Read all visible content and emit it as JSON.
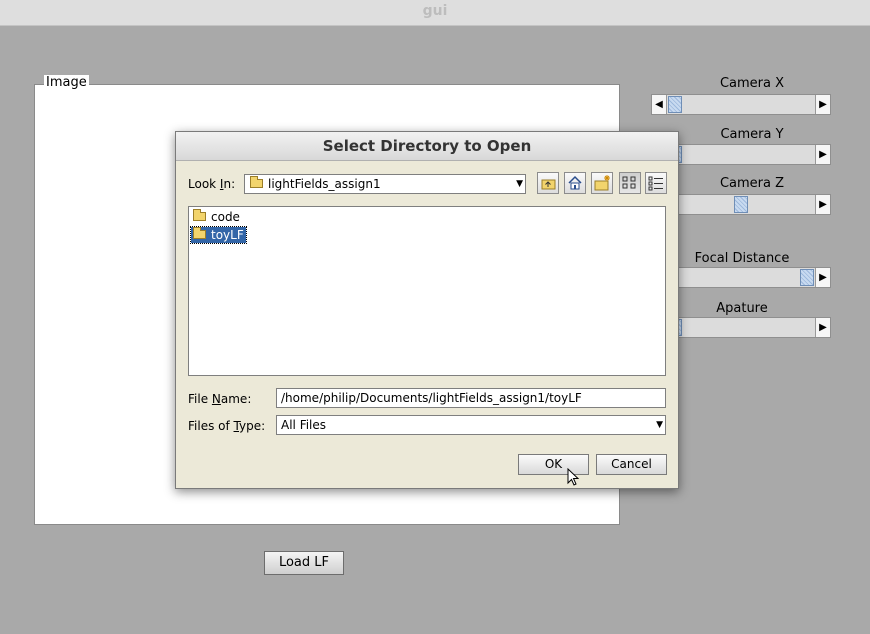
{
  "window": {
    "title": "gui"
  },
  "image_panel": {
    "legend": "Image"
  },
  "load_button": {
    "label": "Load LF"
  },
  "sliders": [
    {
      "label": "Camera X",
      "value_fraction": 0.09
    },
    {
      "label": "Camera Y",
      "value_fraction": 0.05
    },
    {
      "label": "Camera Z",
      "value_fraction": 0.5
    },
    {
      "label": "Focal Distance",
      "value_fraction": 0.97
    },
    {
      "label": "Apature",
      "value_fraction": 0.05
    }
  ],
  "dialog": {
    "title": "Select Directory to Open",
    "look_in_label": "Look In:",
    "look_in_value": "lightFields_assign1",
    "files": [
      {
        "name": "code",
        "selected": false
      },
      {
        "name": "toyLF",
        "selected": true
      }
    ],
    "file_name_label": "File Name:",
    "file_name_value": "/home/philip/Documents/lightFields_assign1/toyLF",
    "files_of_type_label": "Files of Type:",
    "files_of_type_value": "All Files",
    "ok_label": "OK",
    "cancel_label": "Cancel",
    "toolbar_icons": [
      "up-folder-icon",
      "home-icon",
      "new-folder-icon",
      "list-view-icon",
      "details-view-icon"
    ]
  },
  "colors": {
    "background": "#a9a9a9",
    "dialog_background": "#ece9d8",
    "selection": "#3366a8",
    "slider_thumb": "#9db8dc"
  }
}
